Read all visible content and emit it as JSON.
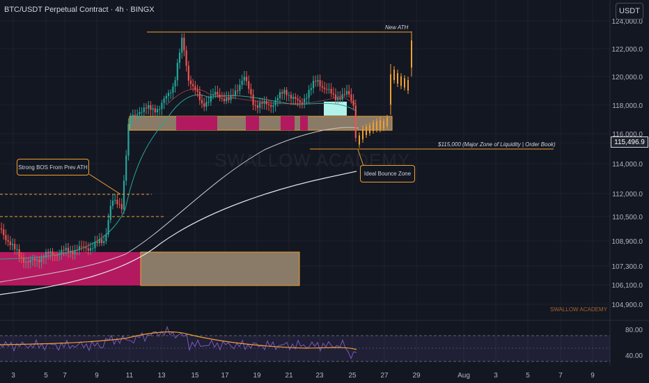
{
  "header": {
    "title": "BTC/USDT Perpetual Contract · 4h · BINGX"
  },
  "currency_button": "USDT",
  "current_price": "115,496.9",
  "watermark": "SWALLOW ACADEMY",
  "brand": "SWALLOW ACADEMY",
  "annotations": {
    "new_ath": "New ATH",
    "liquidity": "$115,000 (Major Zone of Liquidity | Order Book)",
    "bos": "Strong BOS From Prev ATH",
    "bounce": "Ideal Bounce Zone"
  },
  "price_axis": [
    "124,000.0",
    "122,000.0",
    "120,000.0",
    "118,000.0",
    "116,000.0",
    "114,000.0",
    "112,000.0",
    "110,500.0",
    "108,900.0",
    "107,300.0",
    "106,100.0",
    "104,900.0"
  ],
  "rsi_axis": [
    "80.00",
    "40.00"
  ],
  "time_axis": [
    "3",
    "5",
    "7",
    "9",
    "11",
    "13",
    "15",
    "17",
    "19",
    "21",
    "23",
    "25",
    "27",
    "29",
    "Aug",
    "3",
    "5",
    "7",
    "9"
  ],
  "colors": {
    "background": "#131722",
    "up": "#26a69a",
    "down": "#ef5350",
    "orange": "#f0a030",
    "magenta": "#b3195f",
    "zone_fill": "#8a7a68",
    "rsi": "#f0a030"
  },
  "chart_data": {
    "type": "candlestick",
    "symbol": "BTC/USDT",
    "timeframe": "4h",
    "ylim": [
      104500,
      124300
    ],
    "ohlc_overview": [
      {
        "date": "Jul 2",
        "close": 108500
      },
      {
        "date": "Jul 4",
        "close": 108000
      },
      {
        "date": "Jul 6",
        "close": 108300
      },
      {
        "date": "Jul 8",
        "close": 108200
      },
      {
        "date": "Jul 9",
        "close": 109500
      },
      {
        "date": "Jul 10",
        "close": 111500
      },
      {
        "date": "Jul 11",
        "close": 117500
      },
      {
        "date": "Jul 12",
        "close": 117800
      },
      {
        "date": "Jul 13",
        "close": 118500
      },
      {
        "date": "Jul 14",
        "close": 122800
      },
      {
        "date": "Jul 15",
        "close": 117500
      },
      {
        "date": "Jul 16",
        "close": 118300
      },
      {
        "date": "Jul 17",
        "close": 119000
      },
      {
        "date": "Jul 18",
        "close": 118200
      },
      {
        "date": "Jul 19",
        "close": 118000
      },
      {
        "date": "Jul 20",
        "close": 117800
      },
      {
        "date": "Jul 21",
        "close": 119000
      },
      {
        "date": "Jul 22",
        "close": 119500
      },
      {
        "date": "Jul 23",
        "close": 118500
      },
      {
        "date": "Jul 24",
        "close": 118800
      },
      {
        "date": "Jul 25",
        "close": 115500
      }
    ],
    "levels": {
      "new_ath": 123200,
      "liquidity": 115000,
      "supply_zone": [
        116300,
        117300
      ]
    },
    "rsi_levels": [
      80,
      40
    ]
  }
}
